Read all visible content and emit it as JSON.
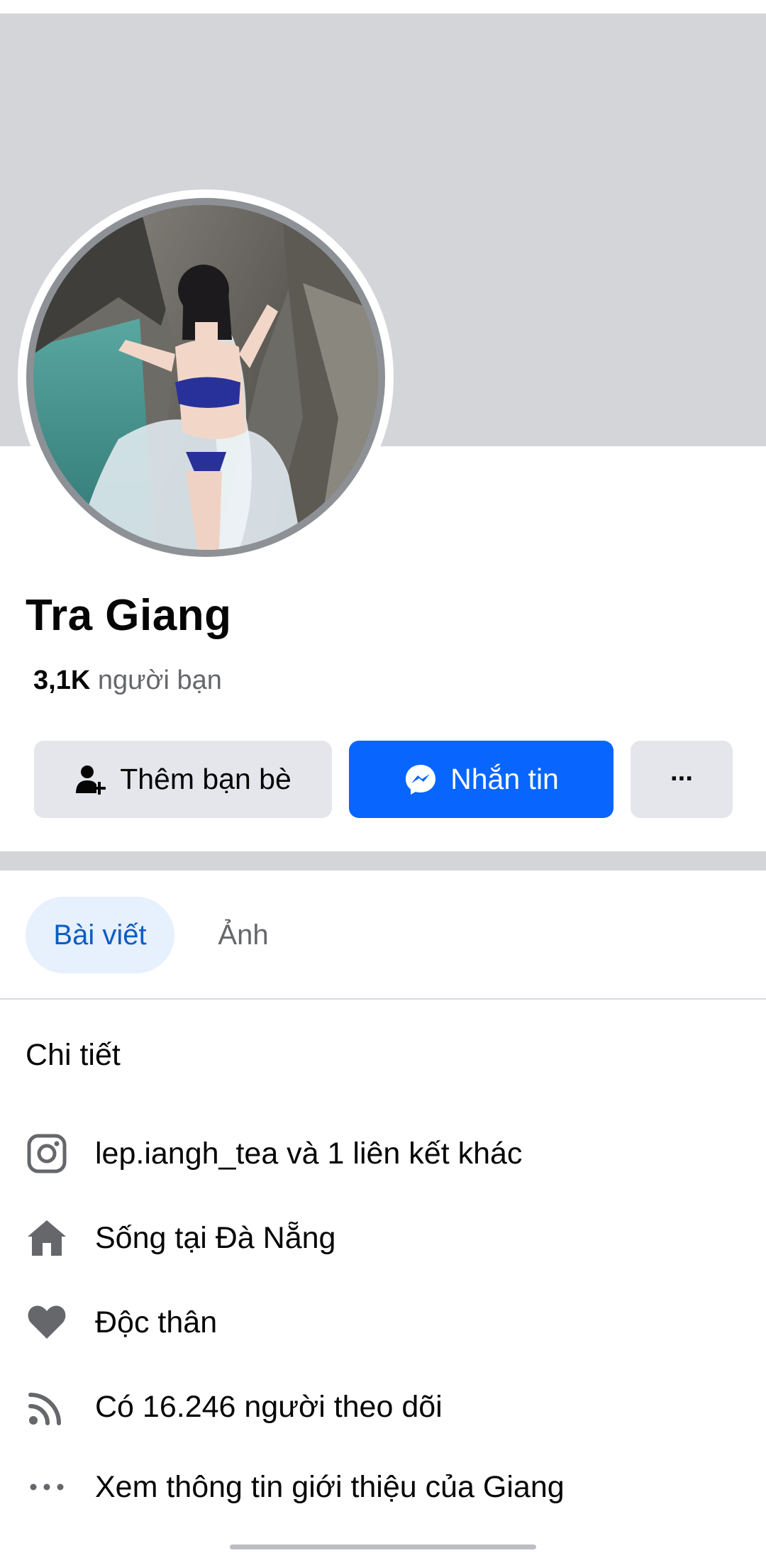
{
  "profile": {
    "name": "Tra Giang",
    "friends_count": "3,1K",
    "friends_label": "người bạn"
  },
  "actions": {
    "add_friend_label": "Thêm bạn bè",
    "message_label": "Nhắn tin",
    "more_label": "···"
  },
  "tabs": [
    {
      "label": "Bài viết",
      "active": true
    },
    {
      "label": "Ảnh",
      "active": false
    }
  ],
  "details": {
    "title": "Chi tiết",
    "items": [
      {
        "icon": "instagram-icon",
        "text": "lep.iangh_tea và 1 liên kết khác"
      },
      {
        "icon": "home-icon",
        "prefix": "Sống tại ",
        "text": "Đà Nẵng"
      },
      {
        "icon": "heart-icon",
        "text": "Độc thân"
      },
      {
        "icon": "rss-icon",
        "text": "Có 16.246 người theo dõi"
      },
      {
        "icon": "more-dots-icon",
        "text": "Xem thông tin giới thiệu của Giang"
      }
    ]
  },
  "colors": {
    "accent": "#0866ff",
    "tab_active_bg": "#e7f0fd",
    "tab_active_text": "#0a5dc2",
    "icon_gray": "#65676b",
    "cover_gray": "#d3d5d9"
  }
}
